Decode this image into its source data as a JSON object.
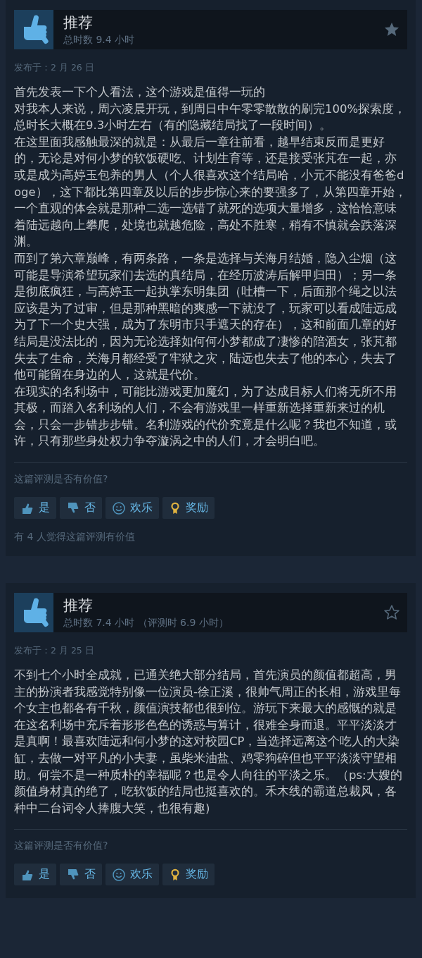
{
  "reviews": [
    {
      "verdict": "推荐",
      "hours": "总时数 9.4 小时",
      "starred": true,
      "posted": "发布于：2 月 26 日",
      "paragraphs": [
        "首先发表一下个人看法，这个游戏是值得一玩的",
        "对我本人来说，周六凌晨开玩，到周日中午零零散散的刷完100%探索度，总时长大概在9.3小时左右（有的隐藏结局找了一段时间）。",
        "在这里面我感触最深的就是：从最后一章往前看，越早结束反而是更好的，无论是对何小梦的软饭硬吃、计划生育等，还是接受张芃在一起，亦或是成为高婷玉包养的男人（个人很喜欢这个结局哈，小元不能没有爸爸doge），这下都比第四章及以后的步步惊心来的要强多了，从第四章开始，一个直观的体会就是那种二选一选错了就死的选项大量增多，这恰恰意味着陆远越向上攀爬，处境也就越危险，高处不胜寒，稍有不慎就会跌落深渊。",
        "而到了第六章巅峰，有两条路，一条是选择与关海月结婚，隐入尘烟（这可能是导演希望玩家们去选的真结局，在经历波涛后解甲归田）；另一条是彻底疯狂，与高婷玉一起执掌东明集团（吐槽一下，后面那个绳之以法应该是为了过审，但是那种黑暗的爽感一下就没了，玩家可以看成陆远成为了下一个史大强，成为了东明市只手遮天的存在），这和前面几章的好结局是没法比的，因为无论选择如何何小梦都成了凄惨的陪酒女，张芃都失去了生命，关海月都经受了牢狱之灾，陆远也失去了他的本心，失去了他可能留在身边的人，这就是代价。",
        "在现实的名利场中，可能比游戏更加魔幻，为了达成目标人们将无所不用其极，而踏入名利场的人们，不会有游戏里一样重新选择重新来过的机会，只会一步错步步错。名利游戏的代价究竟是什么呢？我也不知道，或许，只有那些身处权力争夺漩涡之中的人们，才会明白吧。"
      ],
      "helpful_prompt": "这篇评测是否有价值?",
      "buttons": [
        {
          "kind": "yes",
          "label": "是"
        },
        {
          "kind": "no",
          "label": "否"
        },
        {
          "kind": "funny",
          "label": "欢乐"
        },
        {
          "kind": "award",
          "label": "奖励"
        }
      ],
      "helpful_count": "有 4 人觉得这篇评测有价值"
    },
    {
      "verdict": "推荐",
      "hours": "总时数 7.4 小时 （评测时 6.9 小时）",
      "starred": false,
      "posted": "发布于：2 月 25 日",
      "paragraphs": [
        "不到七个小时全成就，已通关绝大部分结局，首先演员的颜值都超高，男主的扮演者我感觉特别像一位演员-徐正溪，很帅气周正的长相，游戏里每个女主也都各有千秋，颜值演技都也很到位。游玩下来最大的感慨的就是在这名利场中充斥着形形色色的诱惑与算计，很难全身而退。平平淡淡才是真啊！最喜欢陆远和何小梦的这对校园CP，当选择远离这个吃人的大染缸，去做一对平凡的小夫妻，虽柴米油盐、鸡零狗碎但也平平淡淡守望相助。何尝不是一种质朴的幸福呢？也是令人向往的平淡之乐。（ps:大嫂的颜值身材真的绝了，吃软饭的结局也挺喜欢的。禾木线的霸道总裁风，各种中二台词令人捧腹大笑，也很有趣)"
      ],
      "helpful_prompt": "这篇评测是否有价值?",
      "buttons": [
        {
          "kind": "yes",
          "label": "是"
        },
        {
          "kind": "no",
          "label": "否"
        },
        {
          "kind": "funny",
          "label": "欢乐"
        },
        {
          "kind": "award",
          "label": "奖励"
        }
      ]
    }
  ]
}
